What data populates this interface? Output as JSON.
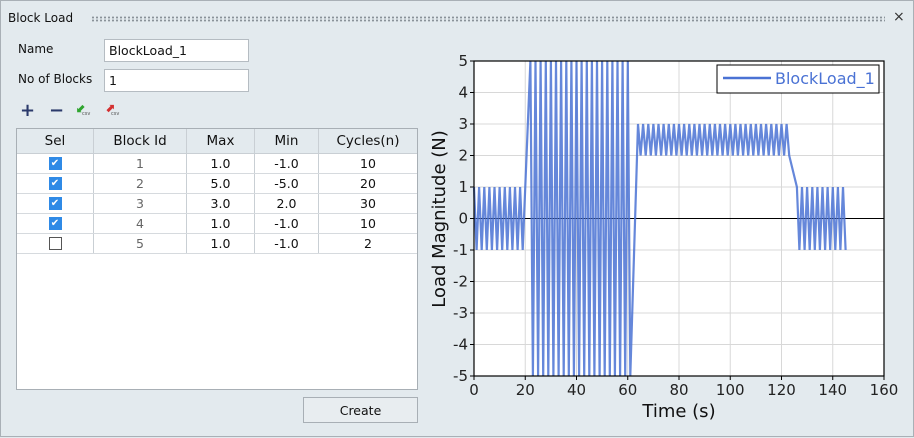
{
  "window": {
    "title": "Block Load",
    "close": "×"
  },
  "form": {
    "name_label": "Name",
    "name_value": "BlockLoad_1",
    "blocks_label": "No of Blocks",
    "blocks_value": "1"
  },
  "toolbar": {
    "add": "+",
    "remove": "−",
    "import_csv": "csv",
    "export_csv": "csv"
  },
  "table": {
    "headers": [
      "Sel",
      "Block Id",
      "Max",
      "Min",
      "Cycles(n)"
    ],
    "rows": [
      {
        "sel": true,
        "id": "1",
        "max": "1.0",
        "min": "-1.0",
        "cycles": "10"
      },
      {
        "sel": true,
        "id": "2",
        "max": "5.0",
        "min": "-5.0",
        "cycles": "20"
      },
      {
        "sel": true,
        "id": "3",
        "max": "3.0",
        "min": "2.0",
        "cycles": "30"
      },
      {
        "sel": true,
        "id": "4",
        "max": "1.0",
        "min": "-1.0",
        "cycles": "10"
      },
      {
        "sel": false,
        "id": "5",
        "max": "1.0",
        "min": "-1.0",
        "cycles": "2"
      }
    ]
  },
  "create_label": "Create",
  "chart_data": {
    "type": "line",
    "xlabel": "Time (s)",
    "ylabel": "Load Magnitude (N)",
    "xlim": [
      0,
      160
    ],
    "ylim": [
      -5,
      5
    ],
    "xticks": [
      "0",
      "20",
      "40",
      "60",
      "80",
      "100",
      "120",
      "140",
      "160"
    ],
    "yticks": [
      "5",
      "4",
      "3",
      "2",
      "1",
      "0",
      "-1",
      "-2",
      "-3",
      "-4",
      "-5"
    ],
    "grid": true,
    "legend": "top-right",
    "color": "#4a72d4",
    "series": [
      {
        "name": "BlockLoad_1",
        "blocks": [
          {
            "start": 0,
            "max": 1,
            "min": -1,
            "cycles": 10
          },
          {
            "start": 22,
            "max": 5,
            "min": -5,
            "cycles": 20
          },
          {
            "start": 64,
            "max": 3,
            "min": 2,
            "cycles": 30
          },
          {
            "start": 126,
            "max": 1,
            "min": -1,
            "cycles": 10
          }
        ]
      }
    ]
  }
}
